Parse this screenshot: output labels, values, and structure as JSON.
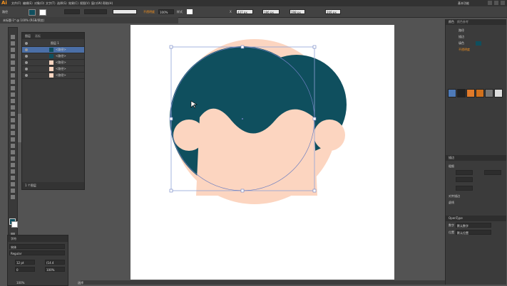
{
  "app": {
    "logo": "Ai",
    "workspace": "基本功能"
  },
  "control": {
    "no_selection_label": "路径",
    "opacity_label": "不透明度",
    "opacity_value": "100%",
    "style_label": "样式",
    "x_label": "X",
    "x_value": "437 px",
    "y_value": "186 px",
    "w_value": "198 px",
    "h_value": "206 px"
  },
  "layers_panel": {
    "tab_layers": "图层",
    "tab_artboards": "画板",
    "rows": [
      "图层 1",
      "<路径>",
      "<路径>",
      "<路径>",
      "<路径>",
      "<路径>"
    ],
    "footer": "1 个图层"
  },
  "right_panel": {
    "color_tab": "颜色",
    "color_guide_tab": "颜色参考",
    "appearance_title": "路径",
    "stroke_label": "描边",
    "fill_label": "填色",
    "effect_label": "不透明度",
    "stroke_panel": "描边",
    "weight_label": "粗细",
    "align_label": "对齐描边",
    "dash_label": "虚线",
    "opentype_title": "OpenType",
    "figure_label": "数字",
    "figure_value": "默认数字",
    "position_label": "位置",
    "position_value": "默认位置"
  },
  "char_panel": {
    "title": "字符",
    "font_value": "宋体",
    "style_value": "Regular",
    "size_value": "12 pt",
    "leading_value": "(14.4",
    "tracking_value": "0",
    "scale_value": "100%"
  },
  "status": {
    "zoom": "100%",
    "tool": "选择"
  },
  "colors": {
    "hair": "#0f4f5e",
    "skin": "#fcd5c0",
    "bounding_box": "#8fa3d8",
    "path_outline": "#6d7fc0"
  }
}
